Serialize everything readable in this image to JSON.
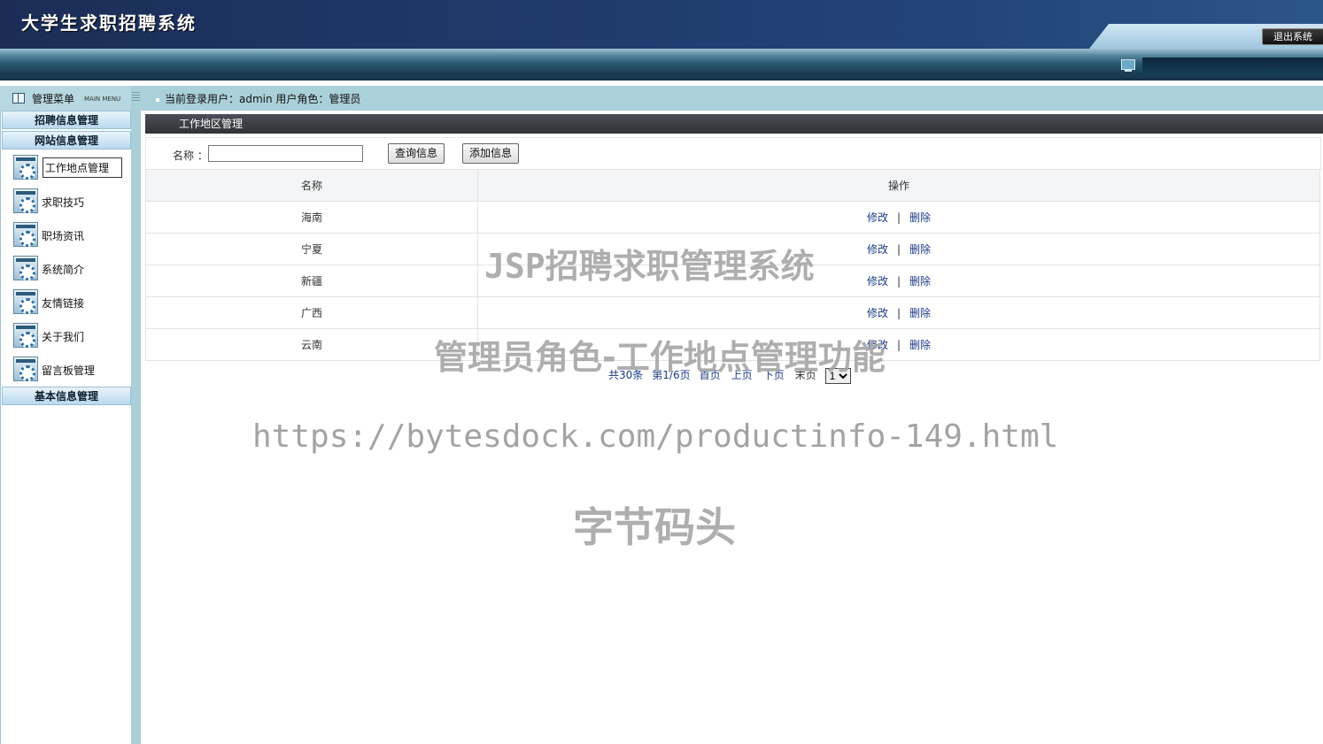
{
  "header": {
    "title": "大学生求职招聘系统",
    "logout_label": "退出系统"
  },
  "menu": {
    "title": "管理菜单",
    "subtitle": "MAIN MENU",
    "sections": [
      {
        "label": "招聘信息管理"
      },
      {
        "label": "网站信息管理"
      },
      {
        "label": "基本信息管理"
      }
    ],
    "items": [
      {
        "label": "工作地点管理",
        "active": true
      },
      {
        "label": "求职技巧"
      },
      {
        "label": "职场资讯"
      },
      {
        "label": "系统简介"
      },
      {
        "label": "友情链接"
      },
      {
        "label": "关于我们"
      },
      {
        "label": "留言板管理"
      }
    ]
  },
  "user_info": "当前登录用户：admin  用户角色：管理员",
  "panel": {
    "title": "工作地区管理",
    "search_label": "名称 ：",
    "search_value": "",
    "query_button": "查询信息",
    "add_button": "添加信息"
  },
  "table": {
    "headers": [
      "名称",
      "操作"
    ],
    "rows": [
      {
        "name": "海南"
      },
      {
        "name": "宁夏"
      },
      {
        "name": "新疆"
      },
      {
        "name": "广西"
      },
      {
        "name": "云南"
      }
    ],
    "edit_label": "修改",
    "separator": "|",
    "delete_label": "删除"
  },
  "pager": {
    "total": "共30条",
    "page_info": "第1/6页",
    "first": "首页",
    "prev": "上页",
    "next": "下页",
    "last": "末页",
    "selected": "1"
  },
  "watermarks": {
    "line1": "JSP招聘求职管理系统",
    "line2": "管理员角色-工作地点管理功能",
    "line3": "https://bytesdock.com/productinfo-149.html",
    "line4": "字节码头"
  }
}
